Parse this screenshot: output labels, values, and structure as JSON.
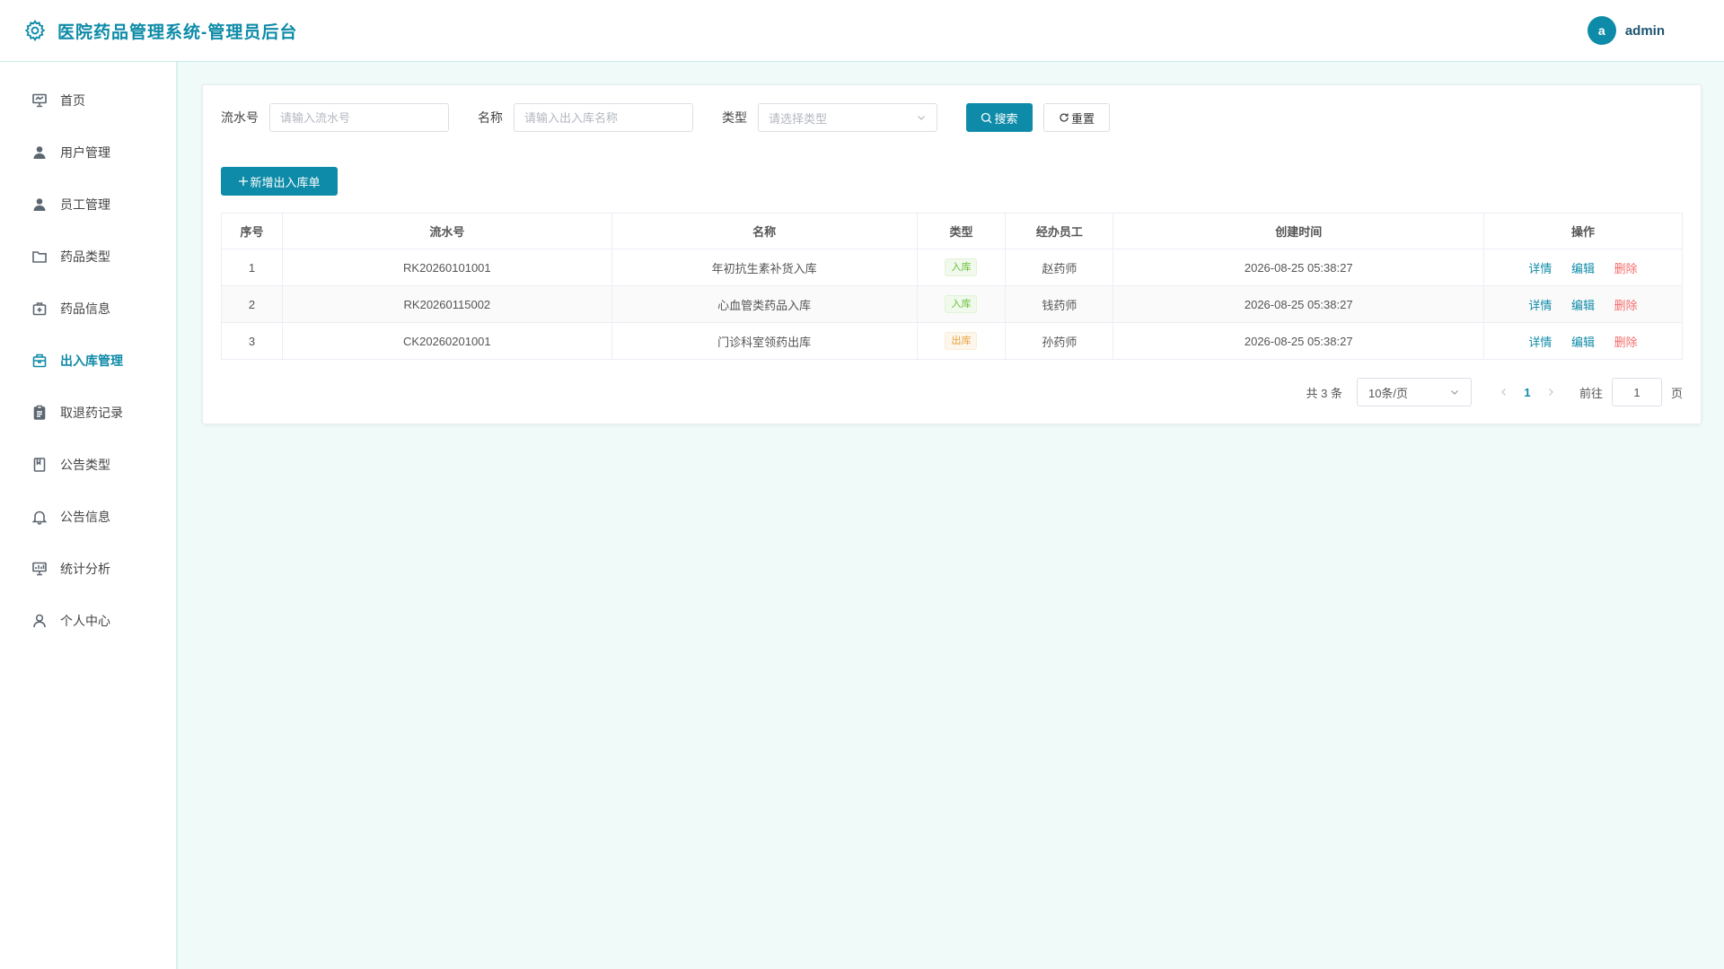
{
  "header": {
    "title": "医院药品管理系统-管理员后台",
    "avatar_letter": "a",
    "username": "admin"
  },
  "sidebar": {
    "items": [
      {
        "label": "首页",
        "icon": "home-board-icon"
      },
      {
        "label": "用户管理",
        "icon": "user-icon"
      },
      {
        "label": "员工管理",
        "icon": "staff-icon"
      },
      {
        "label": "药品类型",
        "icon": "folder-icon"
      },
      {
        "label": "药品信息",
        "icon": "medicine-box-icon"
      },
      {
        "label": "出入库管理",
        "icon": "box-icon",
        "active": true
      },
      {
        "label": "取退药记录",
        "icon": "clipboard-icon"
      },
      {
        "label": "公告类型",
        "icon": "notebook-icon"
      },
      {
        "label": "公告信息",
        "icon": "bell-icon"
      },
      {
        "label": "统计分析",
        "icon": "chart-board-icon"
      },
      {
        "label": "个人中心",
        "icon": "person-icon"
      }
    ]
  },
  "filters": {
    "serial_label": "流水号",
    "serial_placeholder": "请输入流水号",
    "name_label": "名称",
    "name_placeholder": "请输入出入库名称",
    "type_label": "类型",
    "type_placeholder": "请选择类型",
    "search_label": "搜索",
    "reset_label": "重置"
  },
  "add_button": "新增出入库单",
  "table": {
    "columns": [
      "序号",
      "流水号",
      "名称",
      "类型",
      "经办员工",
      "创建时间",
      "操作"
    ],
    "rows": [
      {
        "index": "1",
        "serial": "RK20260101001",
        "name": "年初抗生素补货入库",
        "type": "入库",
        "staff": "赵药师",
        "created": "2026-08-25 05:38:27"
      },
      {
        "index": "2",
        "serial": "RK20260115002",
        "name": "心血管类药品入库",
        "type": "入库",
        "staff": "钱药师",
        "created": "2026-08-25 05:38:27"
      },
      {
        "index": "3",
        "serial": "CK20260201001",
        "name": "门诊科室领药出库",
        "type": "出库",
        "staff": "孙药师",
        "created": "2026-08-25 05:38:27"
      }
    ],
    "actions": {
      "detail": "详情",
      "edit": "编辑",
      "delete": "删除"
    }
  },
  "pagination": {
    "total_text": "共 3 条",
    "page_size": "10条/页",
    "current_page": "1",
    "goto_label": "前往",
    "goto_value": "1",
    "page_suffix": "页"
  },
  "colors": {
    "accent": "#0e8ba8",
    "danger": "#f56c6c",
    "in_tag": "#67c23a",
    "out_tag": "#e6a23c"
  }
}
